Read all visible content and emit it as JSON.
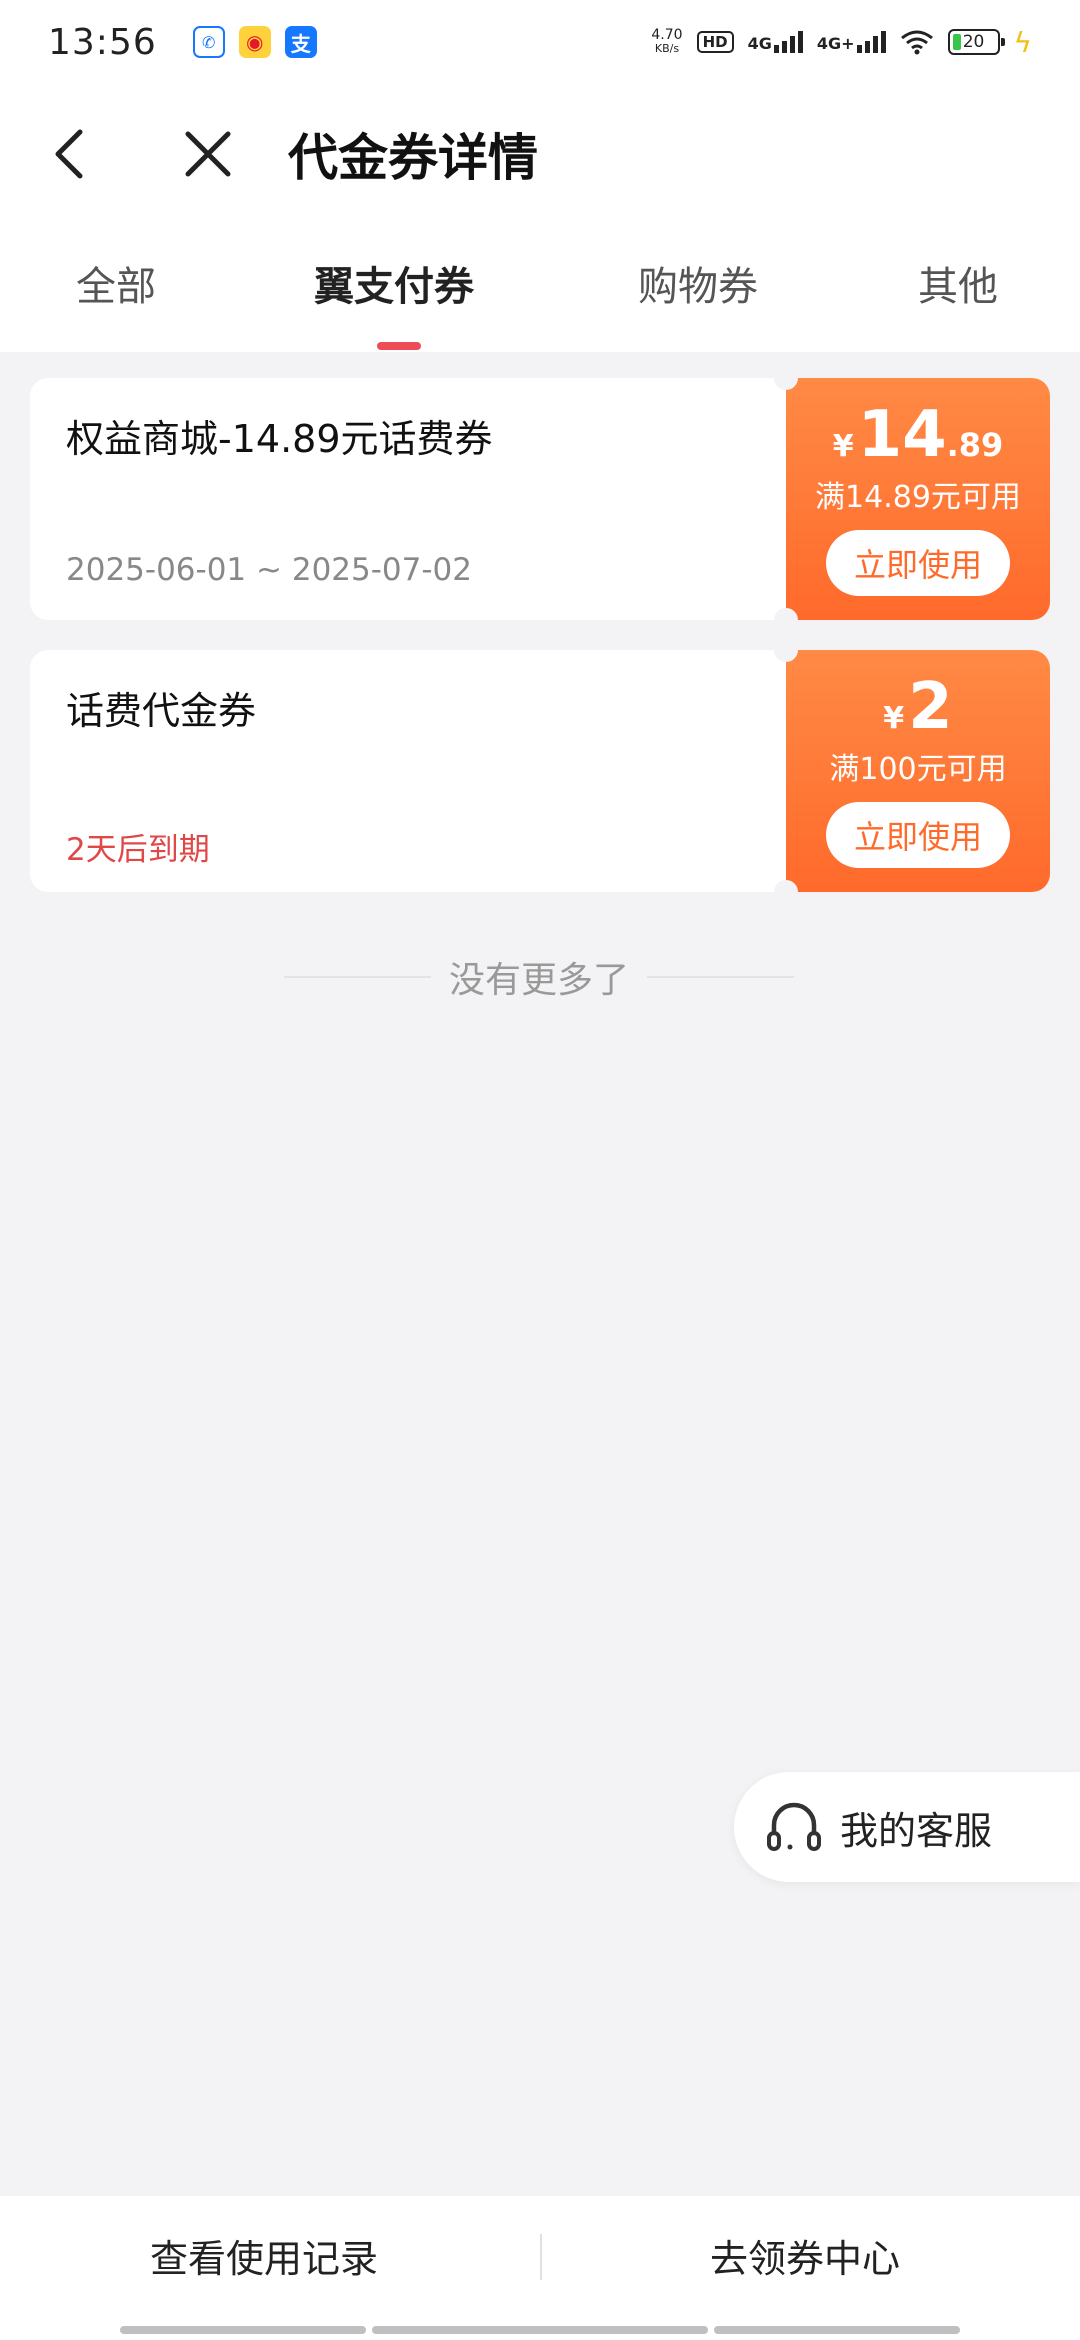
{
  "status_bar": {
    "time": "13:56",
    "net_speed_value": "4.70",
    "net_speed_unit": "KB/s",
    "hd": "HD",
    "sim1": "4G",
    "sim2": "4G+",
    "battery": "20"
  },
  "header": {
    "title": "代金券详情"
  },
  "tabs": [
    {
      "label": "全部"
    },
    {
      "label": "翼支付券"
    },
    {
      "label": "购物券"
    },
    {
      "label": "其他"
    }
  ],
  "active_tab": "翼支付券",
  "coupons": [
    {
      "name": "权益商城-14.89元话费券",
      "validity": "2025-06-01 ~ 2025-07-02",
      "currency": "¥",
      "amount_int": "14",
      "amount_dec": ".89",
      "threshold": "满14.89元可用",
      "button": "立即使用"
    },
    {
      "name": "话费代金券",
      "validity": "2天后到期",
      "currency": "¥",
      "amount_int": "2",
      "amount_dec": "",
      "threshold": "满100元可用",
      "button": "立即使用"
    }
  ],
  "end_text": "没有更多了",
  "service": {
    "label": "我的客服"
  },
  "bottom": {
    "records": "查看使用记录",
    "coupon_center": "去领券中心"
  },
  "colors": {
    "accent": "#ff6a2b",
    "tab_indicator": "#ef4c5a",
    "expire_red": "#e04848"
  }
}
